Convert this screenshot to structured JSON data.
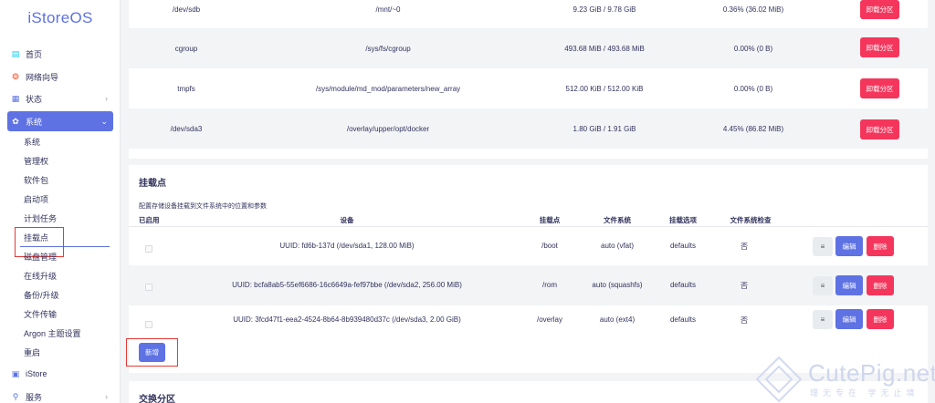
{
  "app": {
    "logo": "iStoreOS"
  },
  "sidebar": {
    "items": [
      {
        "label": "首页",
        "icon": "home-icon",
        "glyph": "▤",
        "color": "#11cdef"
      },
      {
        "label": "网络向导",
        "icon": "wizard-icon",
        "glyph": "❂",
        "color": "#fb6340"
      },
      {
        "label": "状态",
        "icon": "status-icon",
        "glyph": "▦",
        "color": "#5e72e4",
        "chevron": "›"
      },
      {
        "label": "系统",
        "icon": "gear-icon",
        "glyph": "✿",
        "color": "#ffffff",
        "chevron": "⌄"
      }
    ],
    "sub_items": [
      "系统",
      "管理权",
      "软件包",
      "启动项",
      "计划任务",
      "挂载点",
      "磁盘管理",
      "在线升级",
      "备份/升级",
      "文件传输",
      "Argon 主题设置",
      "重启"
    ],
    "bottom_items": [
      {
        "label": "iStore",
        "icon": "istore-icon",
        "glyph": "▣",
        "color": "#5e72e4"
      },
      {
        "label": "服务",
        "icon": "services-icon",
        "glyph": "⚲",
        "color": "#5e72e4",
        "chevron": "›"
      }
    ]
  },
  "partitions": {
    "unmount_label": "卸载分区",
    "rows": [
      {
        "device": "/dev/sdb",
        "mount": "/mnt/~0",
        "size": "9.23 GiB / 9.78 GiB",
        "usage": "0.36% (36.02 MiB)"
      },
      {
        "device": "cgroup",
        "mount": "/sys/fs/cgroup",
        "size": "493.68 MiB / 493.68 MiB",
        "usage": "0.00% (0 B)"
      },
      {
        "device": "tmpfs",
        "mount": "/sys/module/md_mod/parameters/new_array",
        "size": "512.00 KiB / 512.00 KiB",
        "usage": "0.00% (0 B)"
      },
      {
        "device": "/dev/sda3",
        "mount": "/overlay/upper/opt/docker",
        "size": "1.80 GiB / 1.91 GiB",
        "usage": "4.45% (86.82 MiB)"
      }
    ]
  },
  "mountpoints": {
    "title": "挂载点",
    "description": "配置存储设备挂载到文件系统中的位置和参数",
    "headers": [
      "已启用",
      "设备",
      "挂载点",
      "文件系统",
      "挂载选项",
      "文件系统检查"
    ],
    "rows": [
      {
        "device": "UUID: fd6b-137d (/dev/sda1, 128.00 MiB)",
        "mount": "/boot",
        "fs": "auto (vfat)",
        "options": "defaults",
        "check": "否"
      },
      {
        "device": "UUID: bcfa8ab5-55ef6686-16c6649a-fef97bbe (/dev/sda2, 256.00 MiB)",
        "mount": "/rom",
        "fs": "auto (squashfs)",
        "options": "defaults",
        "check": "否"
      },
      {
        "device": "UUID: 3fcd47f1-eea2-4524-8b64-8b939480d37c (/dev/sda3, 2.00 GiB)",
        "mount": "/overlay",
        "fs": "auto (ext4)",
        "options": "defaults",
        "check": "否"
      }
    ],
    "sort_label": "≡",
    "edit_label": "编辑",
    "delete_label": "删除",
    "add_label": "新增"
  },
  "swap": {
    "title": "交换分区"
  },
  "watermark": {
    "text": "CutePig.net",
    "sub": "理无专在 学无止境"
  }
}
